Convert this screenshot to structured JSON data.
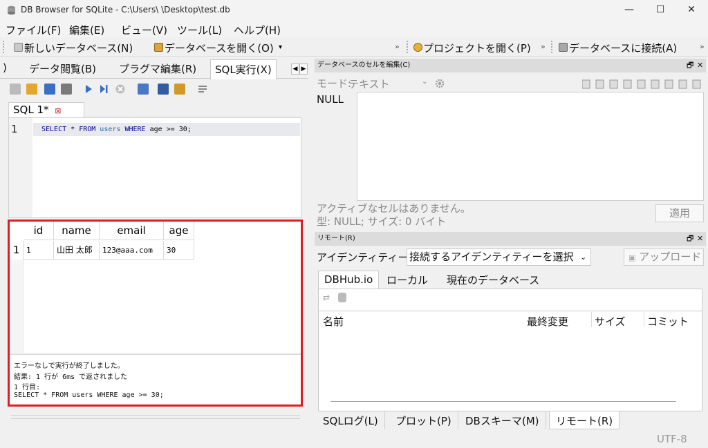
{
  "window": {
    "title": "DB Browser for SQLite - C:\\Users\\          \\Desktop\\test.db",
    "minimize": "—",
    "maximize": "☐",
    "close": "✕"
  },
  "menu": [
    "ファイル(F)",
    "編集(E)",
    "ビュー(V)",
    "ツール(L)",
    "ヘルプ(H)"
  ],
  "toolbar": {
    "new_db": "新しいデータベース(N)",
    "open_db": "データベースを開く(O)",
    "open_project": "プロジェクトを開く(P)",
    "connect_db": "データベースに接続(A)",
    "overflow": "»"
  },
  "tabs": {
    "partial": ")",
    "browse": "データ閲覧(B)",
    "pragma": "プラグマ編集(R)",
    "sql": "SQL実行(X)"
  },
  "sql_tab": {
    "label": "SQL 1*",
    "close": "⊠"
  },
  "editor": {
    "line_no": "1",
    "select_kw": "SELECT",
    "star": " * ",
    "from_kw": "FROM",
    "table": " users ",
    "where_kw": "WHERE",
    "condition": " age >= 30;"
  },
  "results": {
    "columns": [
      "id",
      "name",
      "email",
      "age"
    ],
    "rows": [
      {
        "row_no": "1",
        "cells": [
          "1",
          "山田 太郎",
          "123@aaa.com",
          "30"
        ]
      }
    ],
    "messages": [
      "エラーなしで実行が終了しました。",
      "結果: 1 行が 6ms で返されました",
      "1 行目:",
      "SELECT * FROM users WHERE age >= 30;"
    ]
  },
  "cell_panel": {
    "title": "データベースのセルを編集(C)",
    "mode_label": "モード:",
    "mode_value": "テキスト",
    "value": "NULL",
    "status_line1": "アクティブなセルはありません。",
    "status_line2": "型: NULL; サイズ: 0 バイト",
    "apply": "適用",
    "float_btn": "🗗",
    "close_btn": "✕"
  },
  "remote_panel": {
    "title": "リモート(R)",
    "identity_label": "アイデンティティー",
    "identity_select": "接続するアイデンティティーを選択",
    "upload": "アップロード",
    "tabs": [
      "DBHub.io",
      "ローカル",
      "現在のデータベース"
    ],
    "columns": [
      "名前",
      "最終変更",
      "サイズ",
      "コミット"
    ],
    "float_btn": "🗗",
    "close_btn": "✕"
  },
  "bottom_tabs": [
    "SQLログ(L)",
    "プロット(P)",
    "DBスキーマ(M)",
    "リモート(R)"
  ],
  "status": {
    "encoding": "UTF-8"
  },
  "colors": {
    "highlight_frame": "#e11b22",
    "keyword": "#00008b",
    "identifier": "#2a6e9e"
  }
}
